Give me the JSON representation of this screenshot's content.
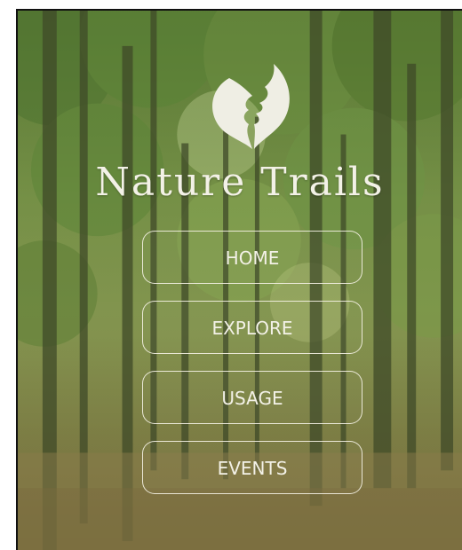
{
  "app": {
    "title": "Nature Trails"
  },
  "logo": {
    "icon": "leaf-profile-icon",
    "color": "#efeee4"
  },
  "menu": {
    "items": [
      {
        "label": "HOME"
      },
      {
        "label": "EXPLORE"
      },
      {
        "label": "USAGE"
      },
      {
        "label": "EVENTS"
      }
    ]
  }
}
